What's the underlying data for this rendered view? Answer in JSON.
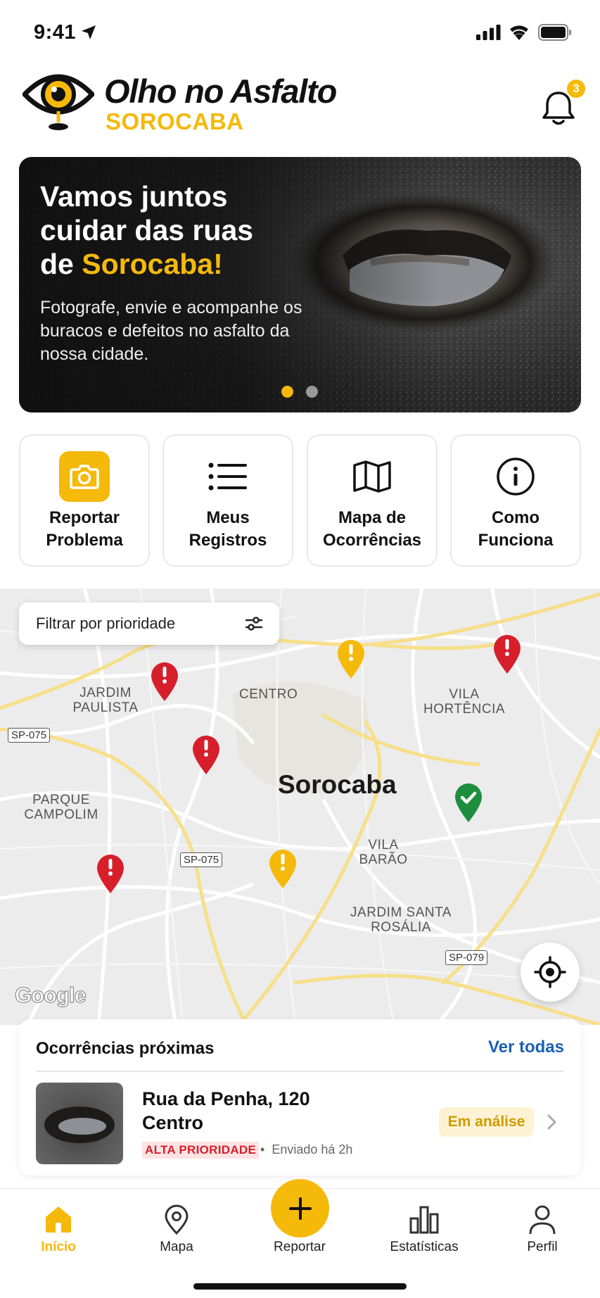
{
  "status_bar": {
    "time": "9:41"
  },
  "header": {
    "app_name": "Olho no Asfalto",
    "city": "SOROCABA",
    "notification_count": "3"
  },
  "hero": {
    "title_line1": "Vamos juntos",
    "title_line2": "cuidar das ruas",
    "title_line3_prefix": "de ",
    "title_line3_highlight": "Sorocaba!",
    "subtitle": "Fotografe, envie e acompanhe os buracos e defeitos no asfalto da nossa cidade.",
    "active_slide": 1,
    "slide_count": 2
  },
  "actions": [
    {
      "label": "Reportar Problema",
      "icon": "camera-icon"
    },
    {
      "label": "Meus Registros",
      "icon": "list-icon"
    },
    {
      "label": "Mapa de Ocorrências",
      "icon": "map-icon"
    },
    {
      "label": "Como Funciona",
      "icon": "info-icon"
    }
  ],
  "map": {
    "filter_label": "Filtrar por prioridade",
    "city_label": "Sorocaba",
    "neighborhoods": {
      "jardim_paulista": "JARDIM PAULISTA",
      "centro": "CENTRO",
      "vila_hortencia": "VILA HORTÊNCIA",
      "parque_campolim": "PARQUE CAMPOLIM",
      "vila_barao": "VILA BARÃO",
      "jardim_santa_rosalia": "JARDIM SANTA ROSÁLIA"
    },
    "road_shields": {
      "sp075_a": "SP-075",
      "sp075_b": "SP-075",
      "sp079": "SP-079"
    },
    "attribution": "Google",
    "pins_legend": {
      "high": "red",
      "medium": "yellow",
      "resolved": "green"
    }
  },
  "nearby": {
    "title": "Ocorrências próximas",
    "see_all": "Ver todas",
    "item": {
      "street": "Rua da Penha, 120",
      "district": "Centro",
      "priority": "ALTA PRIORIDADE",
      "sent": "Enviado há 2h",
      "status": "Em análise"
    }
  },
  "tabs": [
    {
      "label": "Início",
      "icon": "home-icon",
      "active": true
    },
    {
      "label": "Mapa",
      "icon": "map-pin-icon",
      "active": false
    },
    {
      "label": "Reportar",
      "icon": "plus-icon",
      "active": false
    },
    {
      "label": "Estatísticas",
      "icon": "bar-chart-icon",
      "active": false
    },
    {
      "label": "Perfil",
      "icon": "user-icon",
      "active": false
    }
  ],
  "colors": {
    "accent": "#F5B90A",
    "high_priority": "#D61F2B",
    "resolved": "#1E8E3E",
    "link": "#1A5FB4"
  }
}
